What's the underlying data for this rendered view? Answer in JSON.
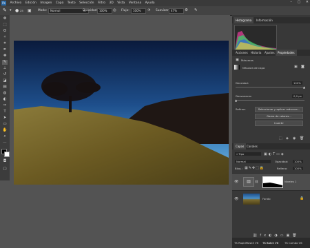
{
  "menu": {
    "app_icon": "Ps",
    "items": [
      "Archivo",
      "Edición",
      "Imagen",
      "Capa",
      "Texto",
      "Selección",
      "Filtro",
      "3D",
      "Vista",
      "Ventana",
      "Ayuda"
    ],
    "window_controls": [
      "–",
      "▢",
      "✕"
    ]
  },
  "options": {
    "modo_label": "Modo:",
    "modo_value": "Normal",
    "opacidad_label": "Opacidad:",
    "opacidad_value": "100%",
    "flujo_label": "Flujo:",
    "flujo_value": "100%",
    "suavizar_label": "Suavizar:",
    "suavizar_value": "47%",
    "brush_size": "25"
  },
  "histogram": {
    "tabs": [
      "Histograma",
      "Información"
    ]
  },
  "props": {
    "tabs": [
      "Acciones",
      "Historia",
      "Ajustes",
      "Propiedades"
    ],
    "section": "Máscaras",
    "mask_label": "Máscara de capa",
    "densidad_label": "Densidad:",
    "densidad_value": "100%",
    "desvanecer_label": "Desvanecer:",
    "desvanecer_value": "0,0 px",
    "refinar_label": "Refinar:",
    "btn_select": "Seleccionar y aplicar máscara...",
    "btn_color": "Gama de colores...",
    "btn_invert": "Invertir"
  },
  "layers": {
    "tabs": [
      "Capas",
      "Canales"
    ],
    "filter": "Tipo",
    "blend": "Normal",
    "opacity_label": "Opacidad:",
    "opacity_value": "100%",
    "lock_label": "Bloq.:",
    "fill_label": "Relleno:",
    "fill_value": "100%",
    "items": [
      {
        "name": "Niveles 1"
      },
      {
        "name": "Fondo"
      }
    ]
  },
  "bottom_tabs": [
    "TK RapidMask5 V6",
    "TK Batch V6",
    "TK Combo V6"
  ],
  "colors": {
    "accent": "#2b6aa8",
    "panel_bg": "#383838",
    "canvas_bg": "#535353"
  }
}
